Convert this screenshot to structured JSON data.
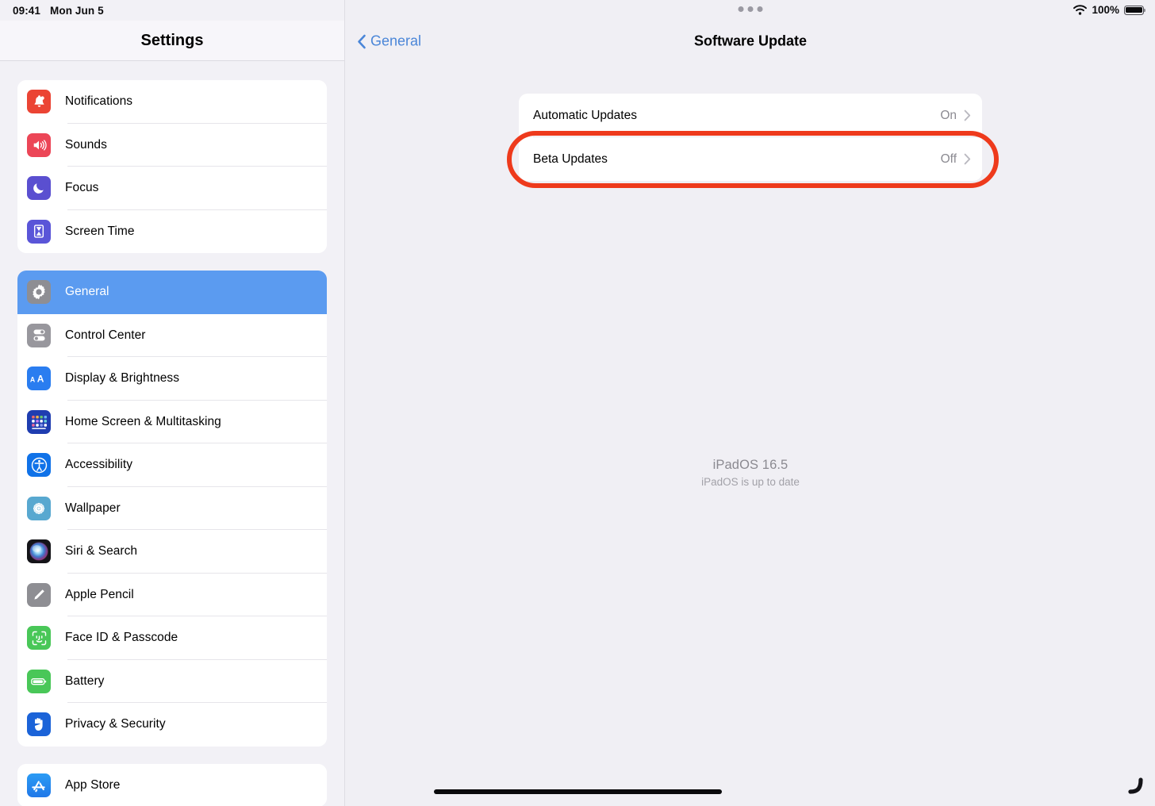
{
  "status_bar": {
    "time": "09:41",
    "date": "Mon Jun 5",
    "wifi_icon": "wifi-icon",
    "battery_percent": "100%",
    "battery_icon": "battery-full-icon"
  },
  "sidebar": {
    "title": "Settings",
    "groups": [
      {
        "items": [
          {
            "label": "Notifications",
            "icon": "bell-icon",
            "icon_class": "ic-notifications",
            "selected": false
          },
          {
            "label": "Sounds",
            "icon": "speaker-icon",
            "icon_class": "ic-sounds",
            "selected": false
          },
          {
            "label": "Focus",
            "icon": "moon-icon",
            "icon_class": "ic-focus",
            "selected": false
          },
          {
            "label": "Screen Time",
            "icon": "hourglass-icon",
            "icon_class": "ic-screentime",
            "selected": false
          }
        ]
      },
      {
        "items": [
          {
            "label": "General",
            "icon": "gear-icon",
            "icon_class": "ic-general",
            "selected": true
          },
          {
            "label": "Control Center",
            "icon": "toggles-icon",
            "icon_class": "ic-controlcenter",
            "selected": false
          },
          {
            "label": "Display & Brightness",
            "icon": "aa-text-icon",
            "icon_class": "ic-display",
            "selected": false
          },
          {
            "label": "Home Screen & Multitasking",
            "icon": "app-grid-icon",
            "icon_class": "ic-homescreen",
            "selected": false
          },
          {
            "label": "Accessibility",
            "icon": "accessibility-icon",
            "icon_class": "ic-accessibility",
            "selected": false
          },
          {
            "label": "Wallpaper",
            "icon": "flower-icon",
            "icon_class": "ic-wallpaper",
            "selected": false
          },
          {
            "label": "Siri & Search",
            "icon": "siri-orb-icon",
            "icon_class": "ic-siri",
            "selected": false
          },
          {
            "label": "Apple Pencil",
            "icon": "pencil-icon",
            "icon_class": "ic-pencil",
            "selected": false
          },
          {
            "label": "Face ID & Passcode",
            "icon": "face-id-icon",
            "icon_class": "ic-faceid",
            "selected": false
          },
          {
            "label": "Battery",
            "icon": "battery-icon",
            "icon_class": "ic-battery",
            "selected": false
          },
          {
            "label": "Privacy & Security",
            "icon": "hand-icon",
            "icon_class": "ic-privacy",
            "selected": false
          }
        ]
      },
      {
        "items": [
          {
            "label": "App Store",
            "icon": "app-store-icon",
            "icon_class": "ic-appstore",
            "selected": false
          }
        ]
      }
    ]
  },
  "detail": {
    "back_label": "General",
    "back_icon": "chevron-left-icon",
    "title": "Software Update",
    "multitask_icon": "multitask-dots-icon",
    "rows": [
      {
        "label": "Automatic Updates",
        "value": "On",
        "chevron": "chevron-right-icon"
      },
      {
        "label": "Beta Updates",
        "value": "Off",
        "chevron": "chevron-right-icon"
      }
    ],
    "version": {
      "name": "iPadOS 16.5",
      "status": "iPadOS is up to date"
    }
  },
  "annotation": {
    "highlight_target": "Beta Updates",
    "highlight_color": "#ee3a1c"
  },
  "colors": {
    "accent_blue": "#4a86d8",
    "selected_row": "#5b9bf0",
    "background": "#f0eff4",
    "card": "#ffffff",
    "secondary_text": "#8b8a91"
  },
  "home_indicator": "home-indicator",
  "corner_hook_icon": "cursor-hook-icon"
}
